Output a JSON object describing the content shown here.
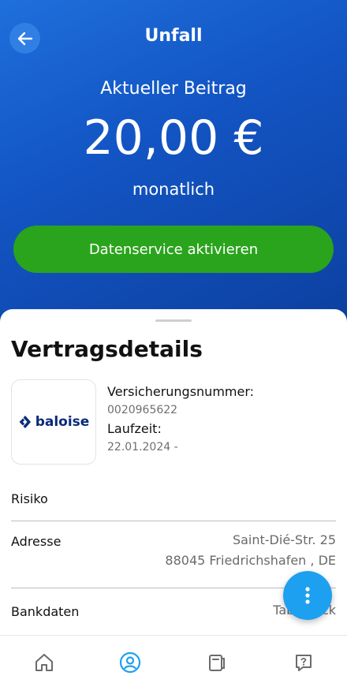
{
  "header": {
    "title": "Unfall",
    "back_icon": "arrow-left-icon",
    "beitrag_label": "Aktueller Beitrag",
    "amount": "20,00 €",
    "period": "monatlich",
    "cta_label": "Datenservice aktivieren",
    "colors": {
      "hero": "#1355c4",
      "cta": "#2aa41c"
    }
  },
  "details": {
    "title": "Vertragsdetails",
    "logo_text": "baloise",
    "versicherungsnummer_label": "Versicherungsnummer:",
    "versicherungsnummer_value": "0020965622",
    "laufzeit_label": "Laufzeit:",
    "laufzeit_value": "22.01.2024 -",
    "rows": [
      {
        "label": "Risiko",
        "value": ""
      },
      {
        "label": "Adresse",
        "value_line1": "Saint-Dié-Str. 25",
        "value_line2": "88045 Friedrichshafen , DE"
      },
      {
        "label": "Bankdaten",
        "value": "Tabe... ick"
      }
    ]
  },
  "fab": {
    "icon": "more-vertical-icon",
    "color": "#1ea0f0"
  },
  "bottom_nav": {
    "items": [
      {
        "icon": "home-icon",
        "active": false
      },
      {
        "icon": "profile-icon",
        "active": true
      },
      {
        "icon": "documents-icon",
        "active": false
      },
      {
        "icon": "help-icon",
        "active": false
      }
    ]
  }
}
